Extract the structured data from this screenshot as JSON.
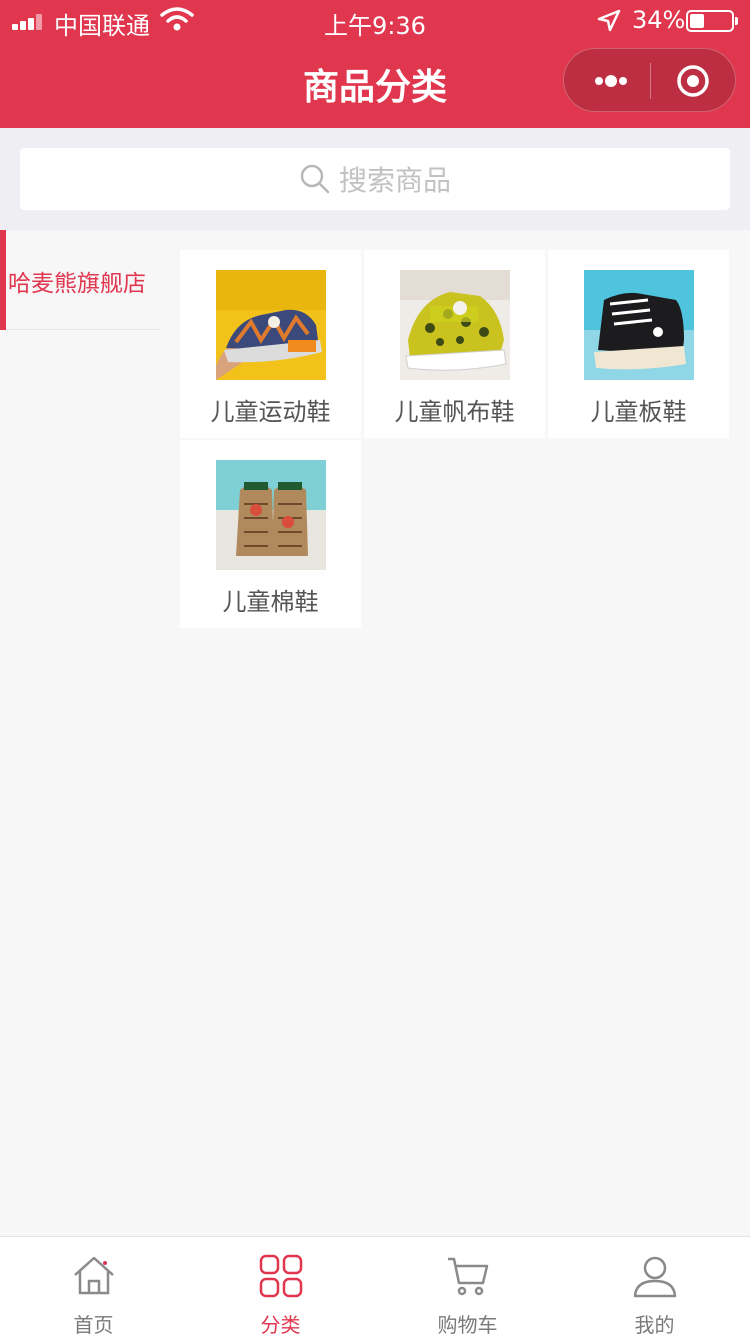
{
  "status_bar": {
    "carrier": "中国联通",
    "time": "上午9:36",
    "battery": "34%",
    "battery_level": 0.34
  },
  "nav": {
    "title": "商品分类",
    "more_icon": "more-dots-icon",
    "close_icon": "target-close-icon"
  },
  "search": {
    "placeholder": "搜索商品",
    "icon": "search-icon"
  },
  "sidebar": {
    "items": [
      {
        "label": "哈麦熊旗舰店",
        "active": true
      }
    ]
  },
  "products": [
    {
      "name": "儿童运动鞋",
      "image": "kids-sneaker-image"
    },
    {
      "name": "儿童帆布鞋",
      "image": "kids-canvas-shoe-image"
    },
    {
      "name": "儿童板鞋",
      "image": "kids-skate-shoe-image"
    },
    {
      "name": "儿童棉鞋",
      "image": "kids-cotton-shoe-image"
    }
  ],
  "tabbar": {
    "tabs": [
      {
        "label": "首页",
        "icon": "home-icon",
        "active": false
      },
      {
        "label": "分类",
        "icon": "category-grid-icon",
        "active": true
      },
      {
        "label": "购物车",
        "icon": "cart-icon",
        "active": false
      },
      {
        "label": "我的",
        "icon": "user-icon",
        "active": false
      }
    ]
  },
  "colors": {
    "primary": "#e0374f",
    "inactive_text": "#7a7a7a",
    "background": "#f7f7f8"
  }
}
